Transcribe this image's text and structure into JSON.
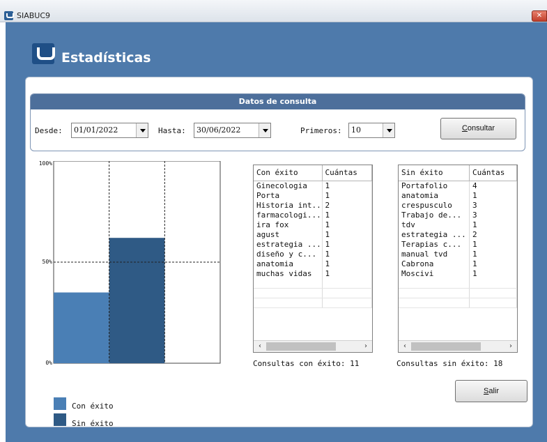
{
  "window": {
    "title": "SIABUC9",
    "close_glyph": "✕"
  },
  "header": {
    "title": "Estadísticas"
  },
  "query": {
    "section_title": "Datos de consulta",
    "desde_label": "Desde:",
    "desde_value": "01/01/2022",
    "hasta_label": "Hasta:",
    "hasta_value": "30/06/2022",
    "primeros_label": "Primeros:",
    "primeros_value": "10",
    "consultar_mnemonic": "C",
    "consultar_rest": "onsultar"
  },
  "chart_data": {
    "type": "bar",
    "categories": [
      "Con éxito",
      "Sin éxito"
    ],
    "values": [
      35,
      62
    ],
    "unit": "%",
    "ylim": [
      0,
      100
    ],
    "yticks": [
      "100%",
      "50%",
      "0%"
    ],
    "colors": [
      "#4a7fb5",
      "#2f5a85"
    ],
    "grid": true,
    "legend": [
      "Con éxito",
      "Sin éxito"
    ],
    "legend_position": "bottom-left"
  },
  "success_table": {
    "columns": [
      "Con éxito",
      "Cuántas"
    ],
    "rows": [
      [
        "Ginecologia",
        "1"
      ],
      [
        "Porta",
        "1"
      ],
      [
        "Historia int...",
        "2"
      ],
      [
        "farmacologi...",
        "1"
      ],
      [
        "ira fox",
        "1"
      ],
      [
        "agust",
        "1"
      ],
      [
        "estrategia ...",
        "1"
      ],
      [
        "diseño y c...",
        "1"
      ],
      [
        "anatomia",
        "1"
      ],
      [
        "muchas vidas",
        "1"
      ]
    ],
    "summary": "Consultas con éxito: 11"
  },
  "fail_table": {
    "columns": [
      "Sin éxito",
      "Cuántas"
    ],
    "rows": [
      [
        "Portafolio",
        "4"
      ],
      [
        "anatomia",
        "1"
      ],
      [
        "crespusculo",
        "3"
      ],
      [
        "Trabajo de...",
        "3"
      ],
      [
        "tdv",
        "1"
      ],
      [
        "estrategia ...",
        "2"
      ],
      [
        "Terapias c...",
        "1"
      ],
      [
        "manual tvd",
        "1"
      ],
      [
        "Cabrona",
        "1"
      ],
      [
        "Moscivi",
        "1"
      ]
    ],
    "summary": "Consultas sin éxito: 18"
  },
  "scroll": {
    "left": "‹",
    "right": "›"
  },
  "buttons": {
    "salir_mnemonic": "S",
    "salir_rest": "alir"
  },
  "colors": {
    "client_bg": "#4e7aab",
    "section_header": "#4d6f9b"
  }
}
